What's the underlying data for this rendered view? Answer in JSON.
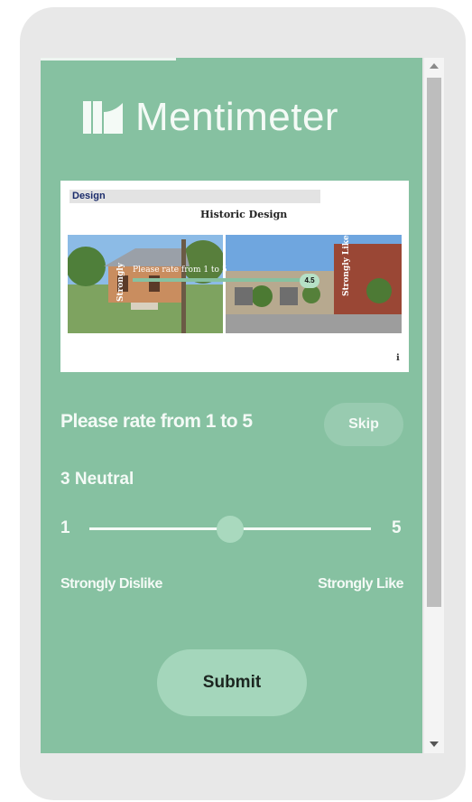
{
  "brand": {
    "name": "Mentimeter",
    "logo_icon": "mentimeter-logo-icon"
  },
  "slide": {
    "tag": "Design",
    "title": "Historic Design",
    "left_vertical_label": "Strongly",
    "right_vertical_label": "Strongly Like",
    "overlay_question": "Please rate from 1 to 5",
    "overlay_value": "4.5"
  },
  "question": {
    "text": "Please rate from 1 to 5",
    "skip_label": "Skip"
  },
  "rating": {
    "current_value": 3,
    "current_label": "3  Neutral",
    "min": 1,
    "max": 5,
    "min_label": "1",
    "max_label": "5",
    "left_anchor": "Strongly Dislike",
    "right_anchor": "Strongly Like"
  },
  "actions": {
    "submit_label": "Submit"
  },
  "colors": {
    "background": "#86c1a1",
    "button": "#a4d6bb",
    "text": "#f4faf6"
  }
}
